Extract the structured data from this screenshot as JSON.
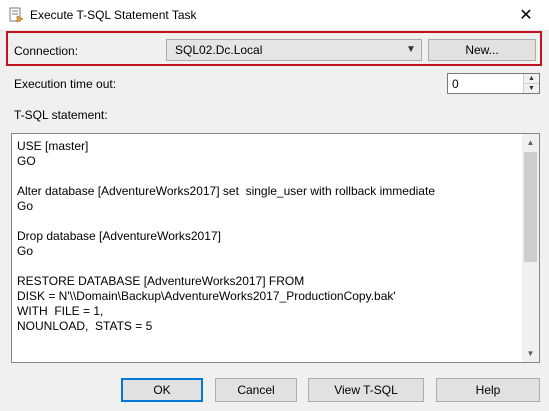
{
  "window": {
    "title": "Execute T-SQL Statement Task",
    "icon": "task-icon",
    "close_glyph": "✕"
  },
  "connection": {
    "label": "Connection:",
    "value": "SQL02.Dc.Local",
    "new_button": "New..."
  },
  "timeout": {
    "label": "Execution time out:",
    "value": "0"
  },
  "statement": {
    "label": "T-SQL statement:",
    "lines": [
      "USE [master]",
      "GO",
      "",
      "Alter database [AdventureWorks2017] set  single_user with rollback immediate",
      "Go",
      "",
      "Drop database [AdventureWorks2017]",
      "Go",
      "",
      "RESTORE DATABASE [AdventureWorks2017] FROM",
      "DISK = N'\\\\Domain\\Backup\\AdventureWorks2017_ProductionCopy.bak'",
      "WITH  FILE = 1,",
      "NOUNLOAD,  STATS = 5"
    ]
  },
  "buttons": {
    "ok": "OK",
    "cancel": "Cancel",
    "view_tsql": "View T-SQL",
    "help": "Help"
  },
  "colors": {
    "highlight_frame": "#c0141c",
    "default_button_border": "#0078d7"
  }
}
